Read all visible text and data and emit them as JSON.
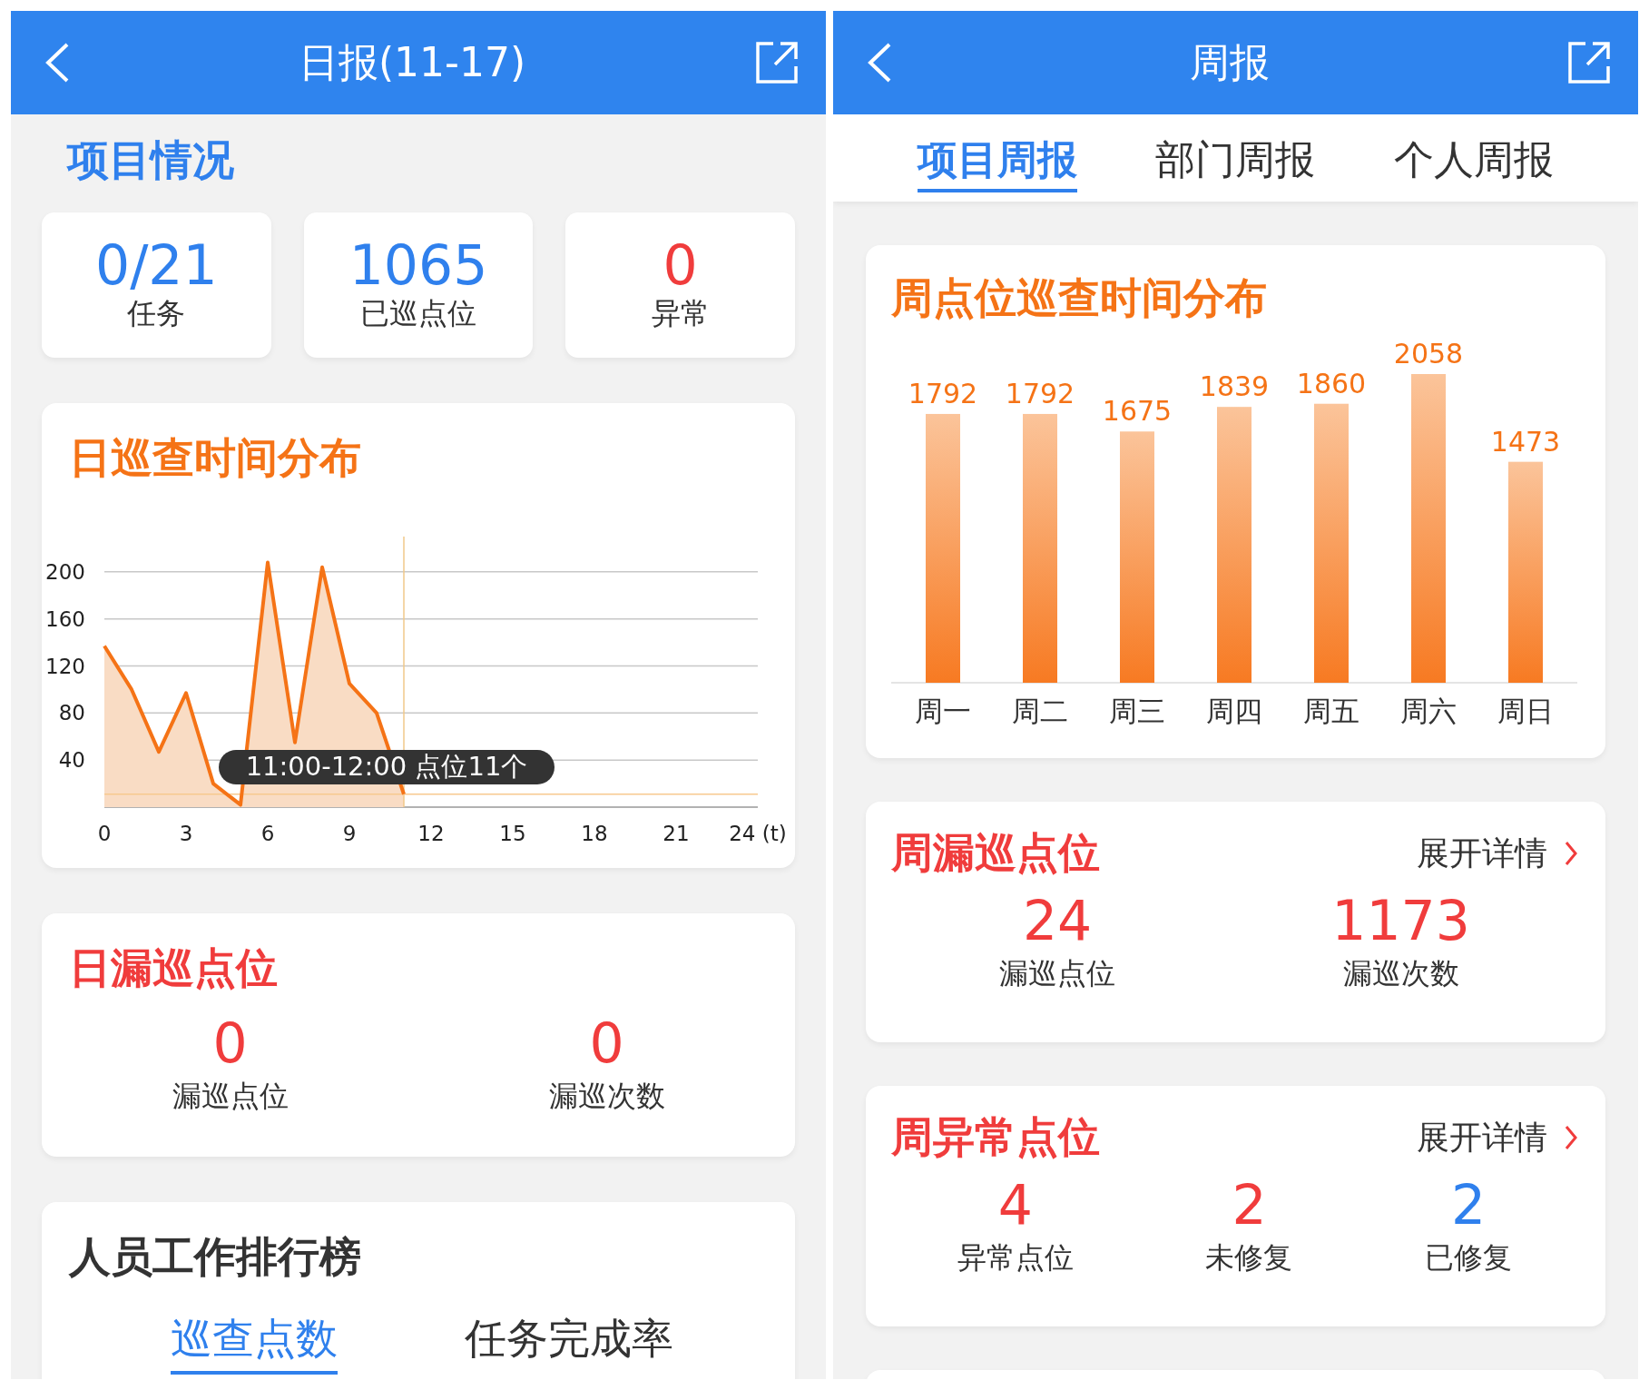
{
  "daily": {
    "header": {
      "title": "日报(11-17)"
    },
    "section_title": "项目情况",
    "stats": [
      {
        "value": "0/21",
        "label": "任务",
        "color": "#2f80ed"
      },
      {
        "value": "1065",
        "label": "已巡点位",
        "color": "#2f80ed"
      },
      {
        "value": "0",
        "label": "异常",
        "color": "#f03c3c"
      }
    ],
    "time_chart": {
      "title": "日巡查时间分布",
      "tooltip": "11:00-12:00  点位11个",
      "chart_data": {
        "type": "area",
        "x": [
          0,
          1,
          2,
          3,
          4,
          5,
          6,
          7,
          8,
          9,
          10,
          11
        ],
        "values": [
          137,
          100,
          47,
          97,
          20,
          2,
          208,
          55,
          204,
          105,
          80,
          11
        ],
        "xlim": [
          0,
          24
        ],
        "ylim": [
          0,
          230
        ],
        "grid": true,
        "ref_lines": [
          {
            "axis": "x",
            "value": 11
          },
          {
            "axis": "y",
            "value": 11
          }
        ],
        "xticks": [
          0,
          3,
          6,
          9,
          12,
          15,
          18,
          21,
          {
            "value": 24,
            "label": "24 (t)"
          }
        ],
        "yticks": [
          40,
          80,
          120,
          160,
          200
        ]
      }
    },
    "missed": {
      "title": "日漏巡点位",
      "stats": [
        {
          "value": "0",
          "label": "漏巡点位"
        },
        {
          "value": "0",
          "label": "漏巡次数"
        }
      ]
    },
    "ranking": {
      "title": "人员工作排行榜",
      "tabs": [
        {
          "label": "巡查点数",
          "selected": true
        },
        {
          "label": "任务完成率",
          "selected": false
        }
      ]
    }
  },
  "weekly": {
    "header": {
      "title": "周报"
    },
    "tabs": [
      {
        "label": "项目周报",
        "selected": true
      },
      {
        "label": "部门周报",
        "selected": false
      },
      {
        "label": "个人周报",
        "selected": false
      }
    ],
    "bar_chart": {
      "title": "周点位巡查时间分布",
      "chart_data": {
        "type": "bar",
        "categories": [
          "周一",
          "周二",
          "周三",
          "周四",
          "周五",
          "周六",
          "周日"
        ],
        "values": [
          1792,
          1792,
          1675,
          1839,
          1860,
          2058,
          1473
        ],
        "data_labels": true
      }
    },
    "missed": {
      "title": "周漏巡点位",
      "link": "展开详情",
      "stats": [
        {
          "value": "24",
          "label": "漏巡点位"
        },
        {
          "value": "1173",
          "label": "漏巡次数"
        }
      ]
    },
    "abnormal": {
      "title": "周异常点位",
      "link": "展开详情",
      "stats": [
        {
          "value": "4",
          "label": "异常点位",
          "color": "#f03c3c"
        },
        {
          "value": "2",
          "label": "未修复",
          "color": "#f03c3c"
        },
        {
          "value": "2",
          "label": "已修复",
          "color": "#2f80ed"
        }
      ]
    }
  }
}
